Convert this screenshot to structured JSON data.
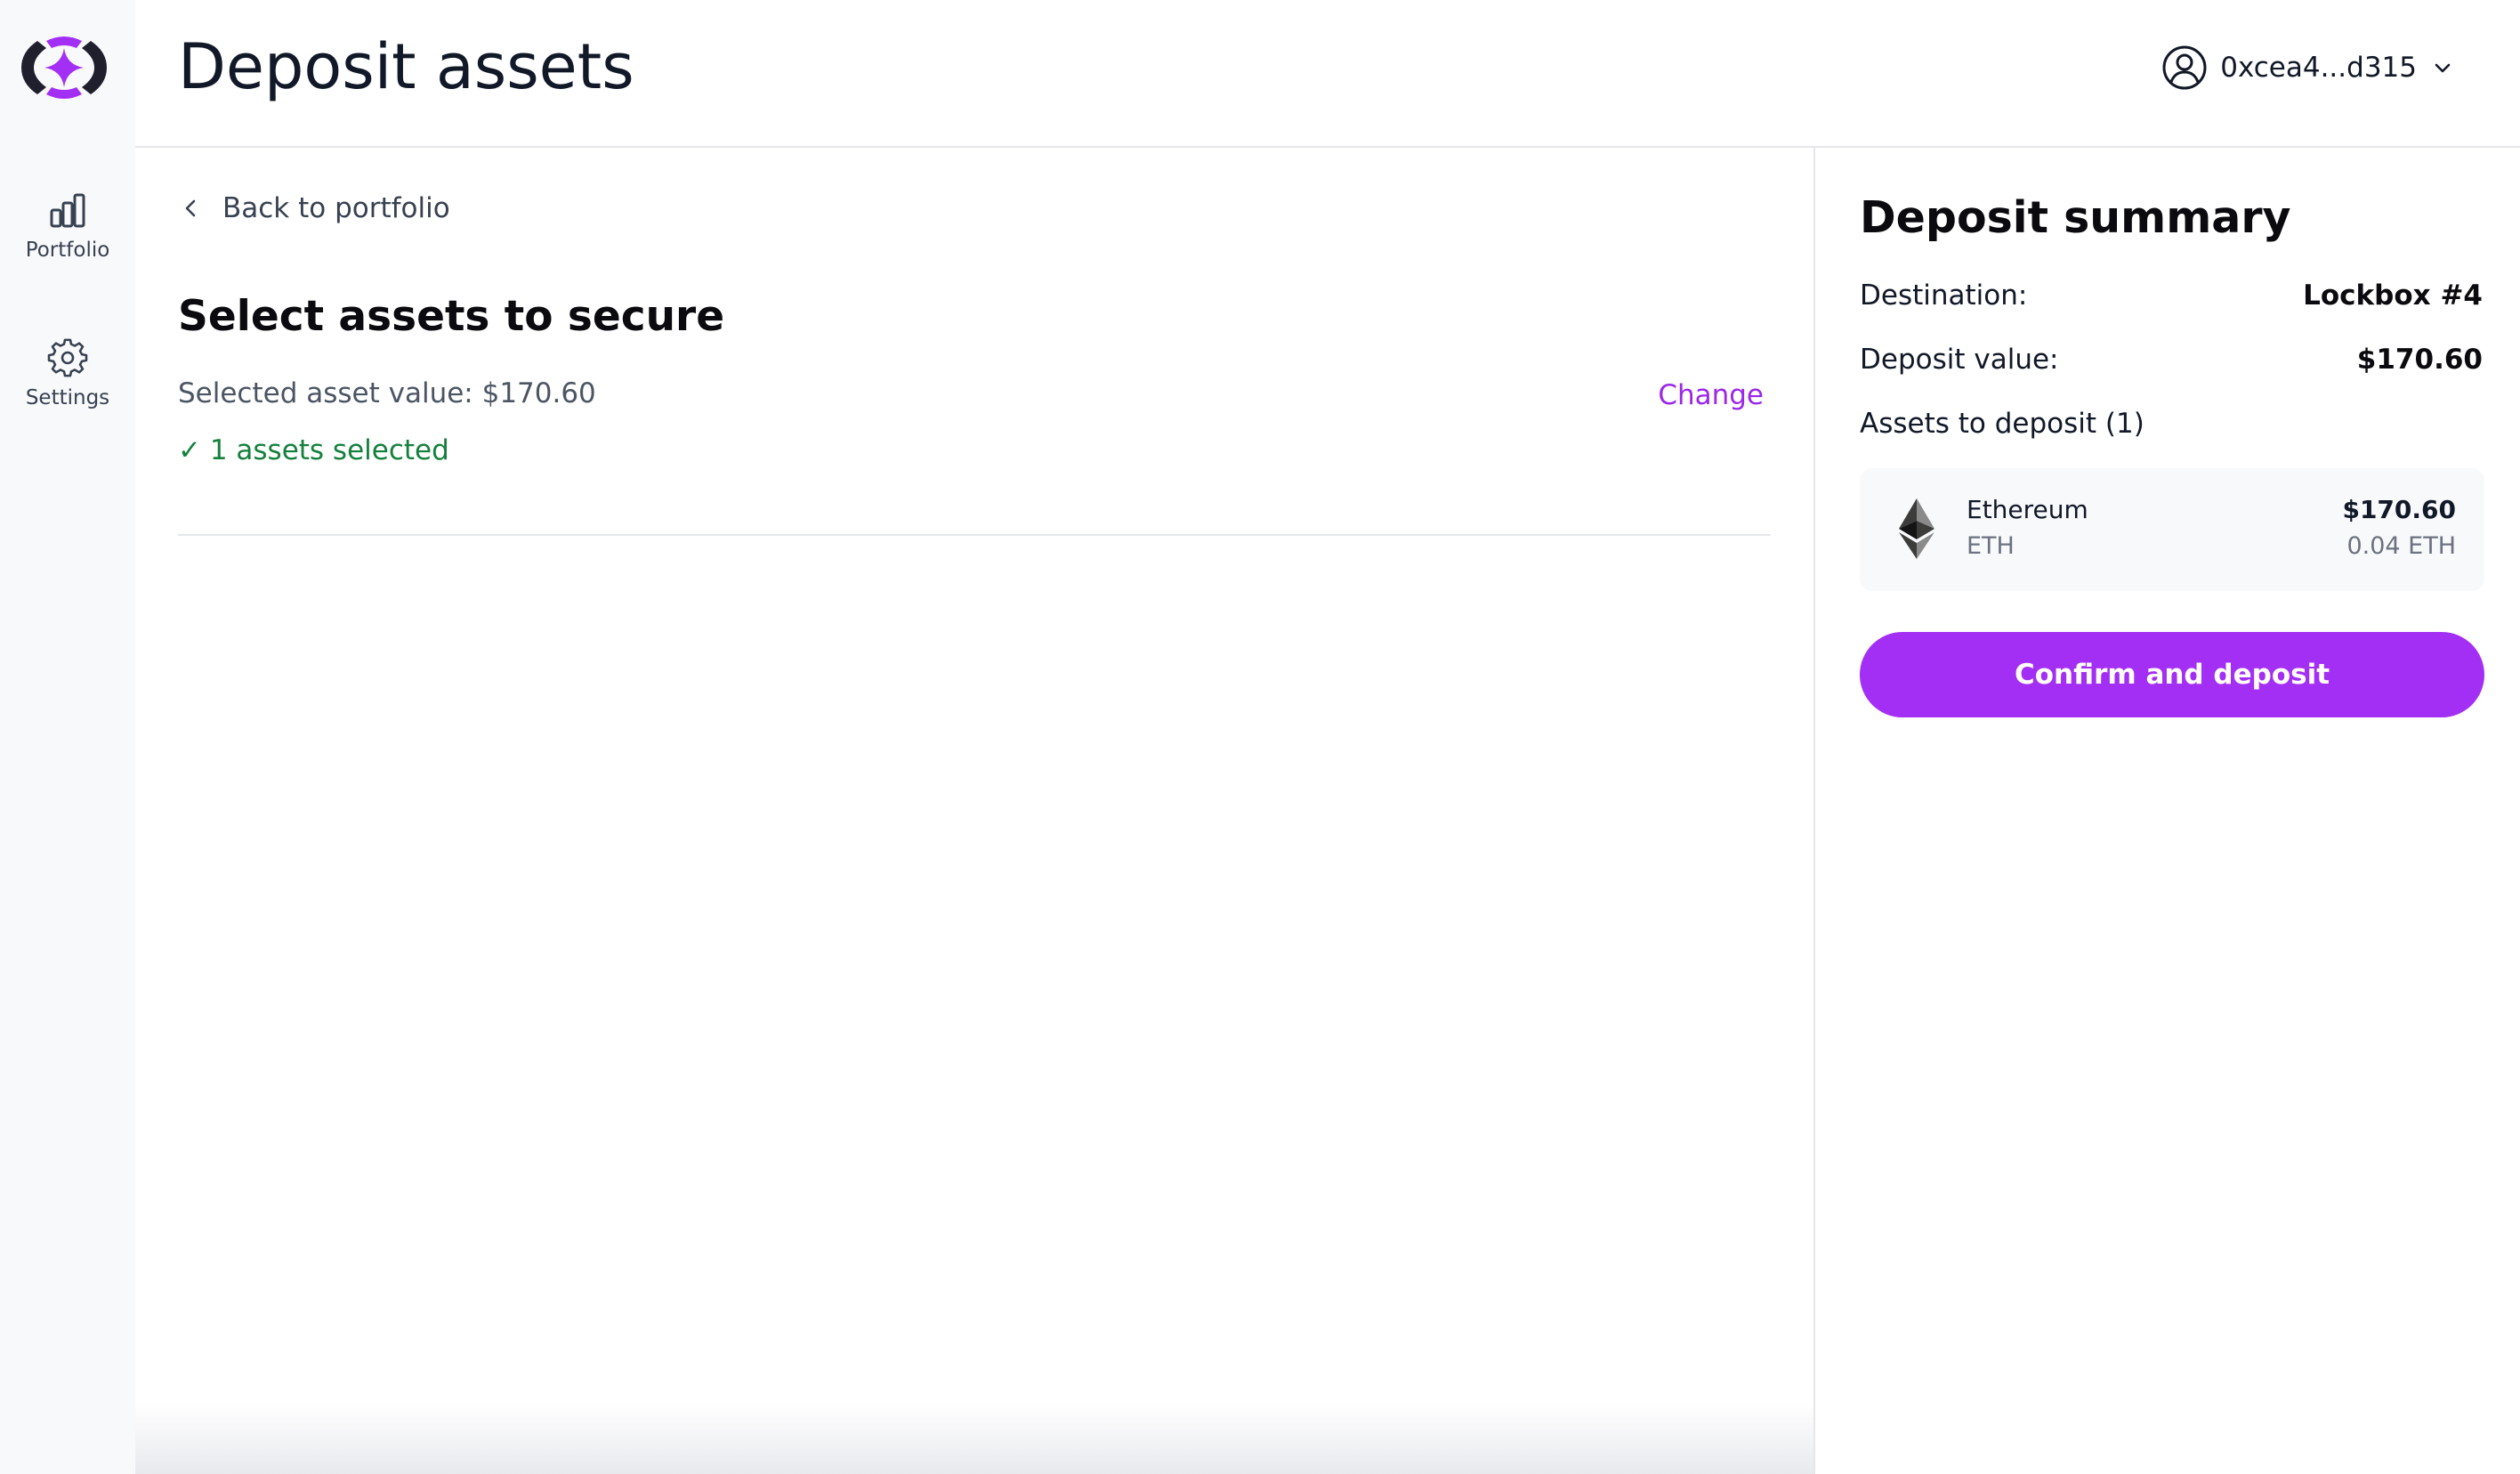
{
  "app": {
    "logo_icon": "brand-logo-icon",
    "accent_color": "#a42ff4",
    "success_color": "#15803d"
  },
  "sidebar": {
    "items": [
      {
        "label": "Portfolio",
        "icon": "bar-chart-icon"
      },
      {
        "label": "Settings",
        "icon": "gear-icon"
      }
    ]
  },
  "header": {
    "title": "Deposit assets",
    "account": {
      "address": "0xcea4...d315",
      "icon": "user-circle-icon",
      "dropdown_icon": "chevron-down-icon"
    }
  },
  "main": {
    "back_label": "Back to portfolio",
    "section_title": "Select assets to secure",
    "selected_value_text": "Selected asset value: $170.60",
    "change_label": "Change",
    "assets_selected_text": "✓ 1 assets selected"
  },
  "summary": {
    "title": "Deposit summary",
    "destination_label": "Destination:",
    "destination_value": "Lockbox #4",
    "deposit_value_label": "Deposit value:",
    "deposit_value": "$170.60",
    "assets_label": "Assets to deposit (1)",
    "assets": [
      {
        "name": "Ethereum",
        "symbol": "ETH",
        "usd_value": "$170.60",
        "amount": "0.04 ETH",
        "icon": "ethereum-icon"
      }
    ],
    "confirm_label": "Confirm and deposit"
  }
}
